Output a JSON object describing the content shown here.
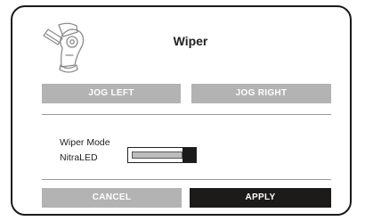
{
  "dialog": {
    "title": "Wiper",
    "icon": "wiper-tool-icon"
  },
  "jog": {
    "left_label": "JOG LEFT",
    "right_label": "JOG RIGHT"
  },
  "wiper_mode": {
    "label": "Wiper Mode",
    "value": "NitraLED",
    "slider_fraction": 1.0
  },
  "actions": {
    "cancel_label": "CANCEL",
    "apply_label": "APPLY"
  },
  "colors": {
    "button_gray": "#b3b3b3",
    "button_dark": "#1d1a1a",
    "border": "#1a1a1a"
  }
}
